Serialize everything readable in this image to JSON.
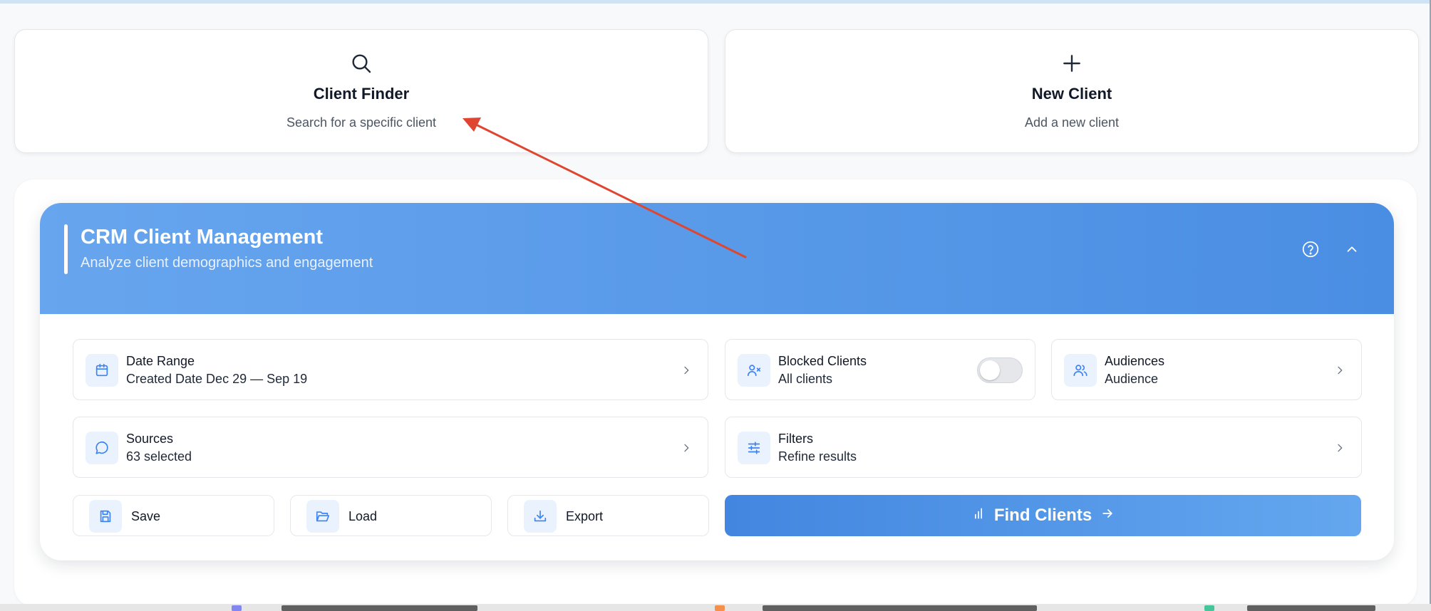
{
  "quick_actions": [
    {
      "icon": "search-icon",
      "title": "Client Finder",
      "subtitle": "Search for a specific client"
    },
    {
      "icon": "plus-icon",
      "title": "New Client",
      "subtitle": "Add a new client"
    }
  ],
  "crm": {
    "title": "CRM Client Management",
    "subtitle": "Analyze client demographics and engagement",
    "header_icons": [
      "help-icon",
      "chevron-up-icon"
    ],
    "tiles": {
      "date_range": {
        "icon": "calendar-icon",
        "label": "Date Range",
        "value": "Created Date Dec 29 — Sep 19"
      },
      "blocked_clients": {
        "icon": "user-x-icon",
        "label": "Blocked Clients",
        "value": "All clients",
        "toggle_on": false
      },
      "audiences": {
        "icon": "users-icon",
        "label": "Audiences",
        "value": "Audience"
      },
      "sources": {
        "icon": "chat-icon",
        "label": "Sources",
        "value": "63 selected"
      },
      "filters": {
        "icon": "sliders-icon",
        "label": "Filters",
        "value": "Refine results"
      }
    },
    "actions": {
      "save": {
        "icon": "save-icon",
        "label": "Save"
      },
      "load": {
        "icon": "folder-open-icon",
        "label": "Load"
      },
      "export": {
        "icon": "download-icon",
        "label": "Export"
      }
    },
    "find_button": {
      "icon": "bar-chart-icon",
      "label": "Find Clients",
      "trailing_icon": "arrow-right-icon"
    }
  },
  "annotation": {
    "type": "arrow",
    "color": "#e0452f"
  },
  "colors": {
    "accent": "#4a8ee3",
    "accent_light": "#67a5ee",
    "icon_bg": "#eaf3fd",
    "icon_stroke": "#3b82f6",
    "page_bg": "#f8f9fb"
  }
}
